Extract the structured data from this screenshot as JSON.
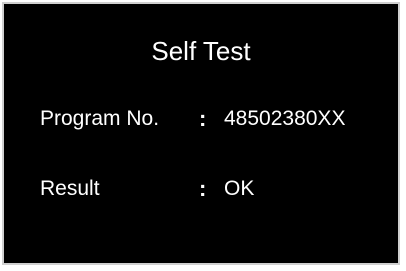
{
  "screen": {
    "title": "Self Test",
    "rows": [
      {
        "label": "Program No.",
        "separator": ":",
        "value": "48502380XX"
      },
      {
        "label": "Result",
        "separator": ":",
        "value": "OK"
      }
    ]
  },
  "colors": {
    "background": "#000000",
    "text": "#ffffff",
    "border": "#cfcfcf"
  }
}
